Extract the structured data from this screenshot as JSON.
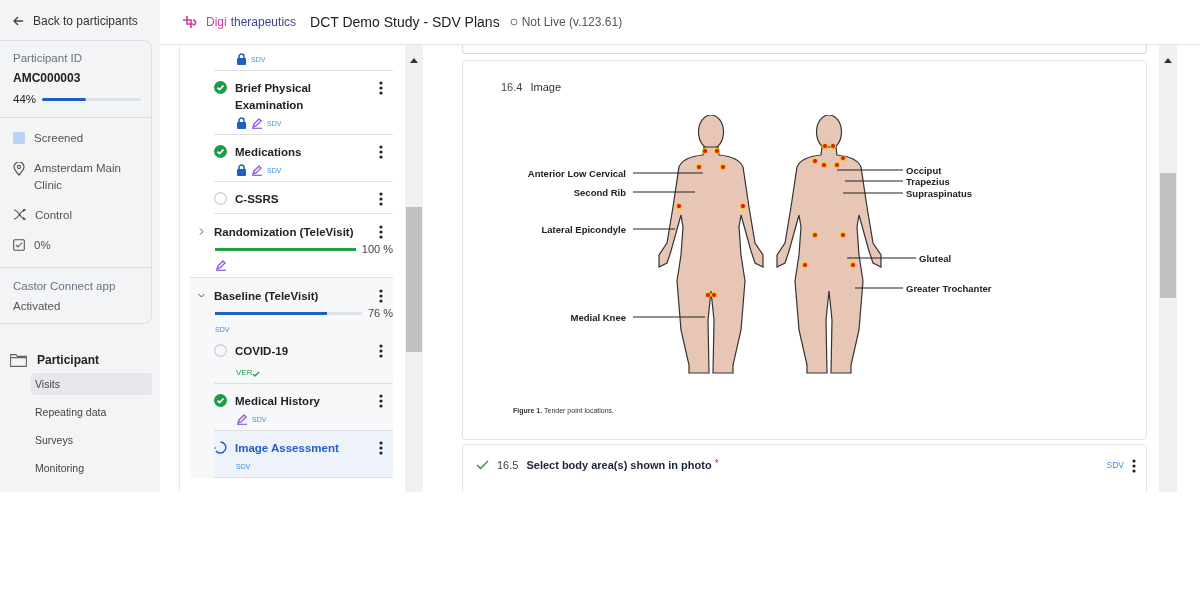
{
  "header": {
    "logo_part_1": "Digi",
    "logo_part_2": "therapeutics",
    "study_title": "DCT Demo Study - SDV Plans",
    "status": "Not Live (v.123.61)"
  },
  "sidebar": {
    "back_link": "Back to participants",
    "participant": {
      "id_label": "Participant ID",
      "id": "AMC000003",
      "progress": "44%",
      "level": 0.44,
      "info": [
        {
          "kind": "status",
          "text": "Screened"
        },
        {
          "kind": "site",
          "text": "Amsterdam Main Clinic"
        },
        {
          "kind": "group",
          "text": "Control"
        },
        {
          "kind": "completion",
          "text": "0%"
        }
      ],
      "app_label": "Castor Connect app",
      "app_status": "Activated"
    },
    "nav": {
      "section": "Participant",
      "items": [
        {
          "label": "Visits",
          "selected": true
        },
        {
          "label": "Repeating data",
          "selected": false
        },
        {
          "label": "Surveys",
          "selected": false
        },
        {
          "label": "Monitoring",
          "selected": false
        }
      ]
    }
  },
  "visit_panel": {
    "forms_above": [
      {
        "kind": "cut_off",
        "selected": false,
        "badges": [
          {
            "kind": "lock"
          },
          {
            "kind": "sdv",
            "label": "SDV"
          }
        ]
      },
      {
        "name": "Brief Physical Examination",
        "kind": "complete",
        "selected": false,
        "badges": [
          {
            "kind": "lock"
          },
          {
            "kind": "edit"
          },
          {
            "kind": "sdv",
            "label": "SDV"
          }
        ]
      },
      {
        "name": "Medications",
        "kind": "complete",
        "selected": false,
        "badges": [
          {
            "kind": "lock"
          },
          {
            "kind": "edit"
          },
          {
            "kind": "sdv",
            "label": "SDV"
          }
        ]
      },
      {
        "name": "C-SSRS",
        "kind": "pending",
        "selected": false
      }
    ],
    "visits": [
      {
        "name": "Randomization (TeleVisit)",
        "expanded": false,
        "level": 1,
        "percent": "100 %",
        "color": "#22a045",
        "badges": [
          {
            "kind": "edit"
          }
        ]
      },
      {
        "name": "Baseline (TeleVisit)",
        "expanded": true,
        "level": 0.76,
        "percent": "76 %",
        "color": "#1f5fc4",
        "badges": [
          {
            "kind": "sdv",
            "label": "SDV"
          }
        ],
        "children": [
          {
            "name": "COVID-19",
            "kind": "pending",
            "selected": false,
            "badges": [
              {
                "kind": "verified",
                "label": "VER"
              }
            ]
          },
          {
            "name": "Medical History",
            "kind": "complete",
            "selected": false,
            "badges": [
              {
                "kind": "edit"
              },
              {
                "kind": "sdv",
                "label": "SDV"
              }
            ]
          },
          {
            "name": "Image Assessment",
            "kind": "in_progress",
            "selected": true,
            "badges": [
              {
                "kind": "sdv",
                "label": "SDV"
              }
            ]
          }
        ]
      }
    ]
  },
  "questions": [
    {
      "kind": "image",
      "number": "16.4",
      "label": "Image",
      "figure": {
        "left_labels": [
          "Anterior Low Cervical",
          "Second Rib",
          "Lateral Epicondyle",
          "Medial Knee"
        ],
        "right_labels": [
          "Occiput",
          "Trapezius",
          "Supraspinatus",
          "Gluteal",
          "Greater Trochanter"
        ],
        "caption": "**Figure 1.** Tender point locations."
      }
    },
    {
      "kind": "select",
      "checked": true,
      "number": "16.5",
      "label": "Select body area(s) shown in photo",
      "required_mark": "*",
      "sdv": "SDV"
    }
  ]
}
